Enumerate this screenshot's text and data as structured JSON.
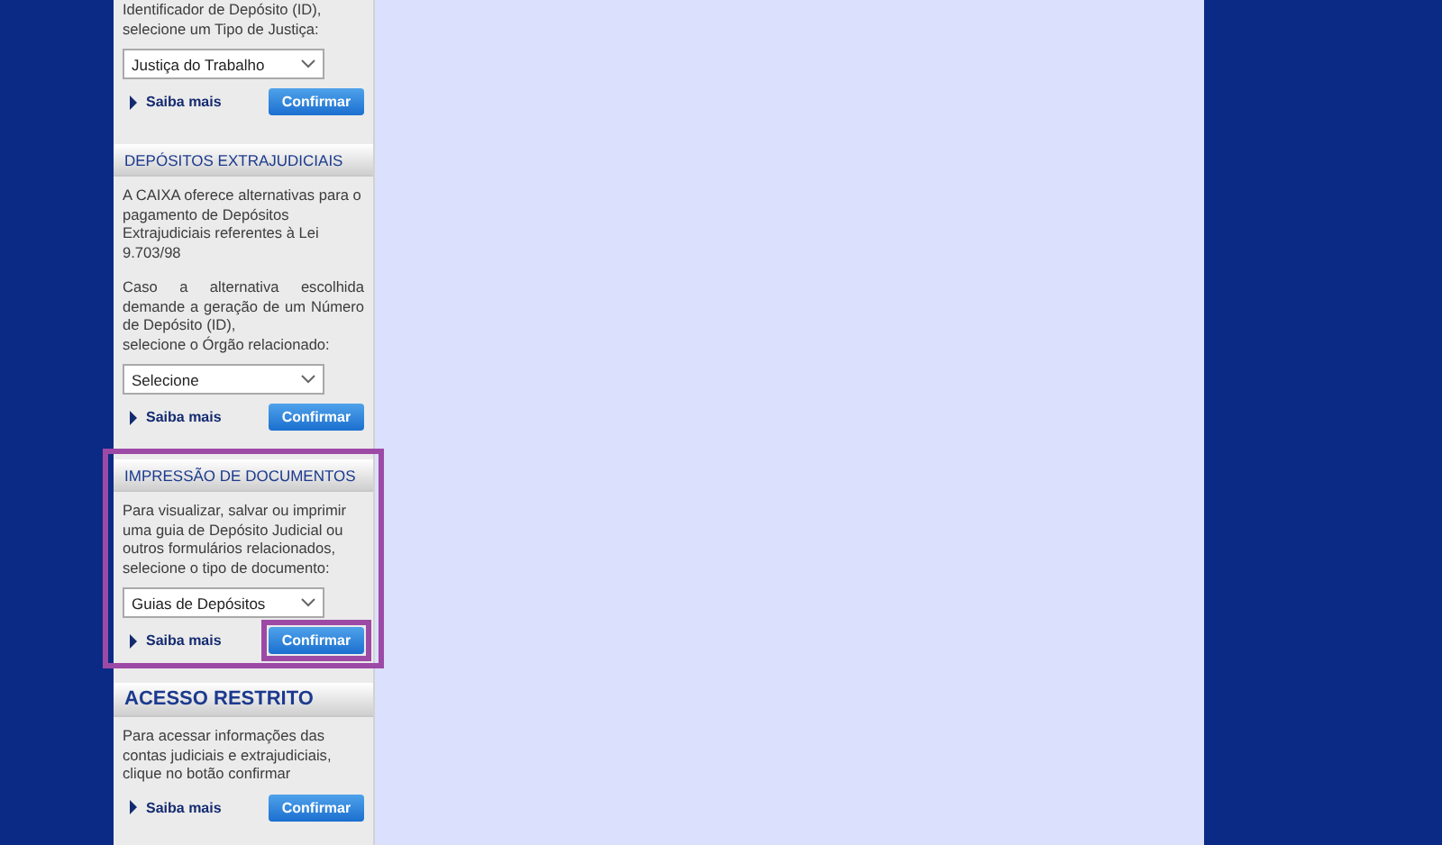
{
  "sections": [
    {
      "kind": "plain",
      "paragraphs": [
        {
          "text": "Identificador de Depósito (ID),\nselecione um Tipo de Justiça:"
        }
      ],
      "select": "Justiça do Trabalho",
      "link": "Saiba mais",
      "button": {
        "label": "Confirmar"
      }
    },
    {
      "kind": "compact",
      "title": "DEPÓSITOS EXTRAJUDICIAIS",
      "paragraphs": [
        {
          "text": "A CAIXA oferece alternativas para o pagamento de Depósitos Extrajudiciais referentes à Lei 9.703/98"
        },
        {
          "text": "Caso a alternativa escolhida demande a geração de um Número de Depósito (ID),\nselecione o Órgão relacionado:",
          "justified": true
        }
      ],
      "select": "Selecione",
      "link": "Saiba mais",
      "button": {
        "label": "Confirmar"
      }
    },
    {
      "kind": "compact",
      "title": "IMPRESSÃO DE DOCUMENTOS",
      "highlighted": true,
      "paragraphs": [
        {
          "text": "Para visualizar, salvar ou imprimir uma guia de Depósito Judicial ou outros formulários relacionados, selecione o tipo de documento:"
        }
      ],
      "select": "Guias de Depósitos",
      "link": "Saiba mais",
      "button": {
        "label": "Confirmar",
        "highlighted": true
      }
    },
    {
      "kind": "prominent",
      "title": "ACESSO RESTRITO",
      "paragraphs": [
        {
          "text": "Para acessar informações das contas judiciais e extrajudiciais, clique no botão confirmar"
        }
      ],
      "link": "Saiba mais",
      "button": {
        "label": "Confirmar"
      }
    }
  ]
}
